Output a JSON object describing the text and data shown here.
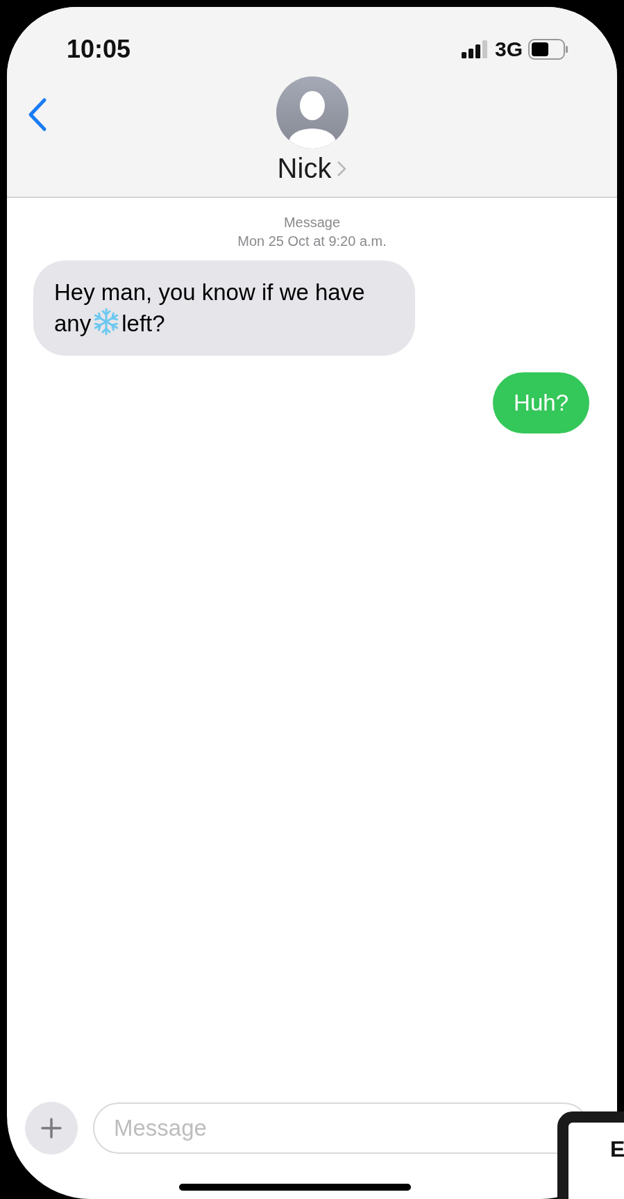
{
  "status_bar": {
    "time": "10:05",
    "network": "3G"
  },
  "contact": {
    "name": "Nick"
  },
  "thread_header": {
    "service": "Message",
    "date": "Mon 25 Oct",
    "time": " at 9:20 a.m."
  },
  "messages": [
    {
      "kind": "incoming",
      "parts": [
        {
          "kind": "text",
          "text": "Hey man, you know if we have any"
        },
        {
          "kind": "snowflake"
        },
        {
          "kind": "text",
          "text": "left?"
        }
      ]
    },
    {
      "kind": "outgoing",
      "parts": [
        {
          "kind": "text",
          "text": "Huh?"
        }
      ]
    }
  ],
  "composer": {
    "placeholder": "Message"
  },
  "overlay_card": {
    "text": "E"
  }
}
